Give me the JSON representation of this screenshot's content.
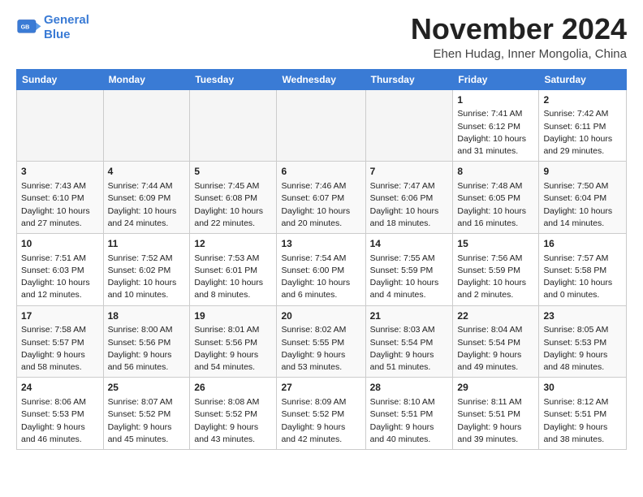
{
  "header": {
    "logo_line1": "General",
    "logo_line2": "Blue",
    "month": "November 2024",
    "location": "Ehen Hudag, Inner Mongolia, China"
  },
  "weekdays": [
    "Sunday",
    "Monday",
    "Tuesday",
    "Wednesday",
    "Thursday",
    "Friday",
    "Saturday"
  ],
  "weeks": [
    [
      {
        "day": "",
        "info": ""
      },
      {
        "day": "",
        "info": ""
      },
      {
        "day": "",
        "info": ""
      },
      {
        "day": "",
        "info": ""
      },
      {
        "day": "",
        "info": ""
      },
      {
        "day": "1",
        "info": "Sunrise: 7:41 AM\nSunset: 6:12 PM\nDaylight: 10 hours\nand 31 minutes."
      },
      {
        "day": "2",
        "info": "Sunrise: 7:42 AM\nSunset: 6:11 PM\nDaylight: 10 hours\nand 29 minutes."
      }
    ],
    [
      {
        "day": "3",
        "info": "Sunrise: 7:43 AM\nSunset: 6:10 PM\nDaylight: 10 hours\nand 27 minutes."
      },
      {
        "day": "4",
        "info": "Sunrise: 7:44 AM\nSunset: 6:09 PM\nDaylight: 10 hours\nand 24 minutes."
      },
      {
        "day": "5",
        "info": "Sunrise: 7:45 AM\nSunset: 6:08 PM\nDaylight: 10 hours\nand 22 minutes."
      },
      {
        "day": "6",
        "info": "Sunrise: 7:46 AM\nSunset: 6:07 PM\nDaylight: 10 hours\nand 20 minutes."
      },
      {
        "day": "7",
        "info": "Sunrise: 7:47 AM\nSunset: 6:06 PM\nDaylight: 10 hours\nand 18 minutes."
      },
      {
        "day": "8",
        "info": "Sunrise: 7:48 AM\nSunset: 6:05 PM\nDaylight: 10 hours\nand 16 minutes."
      },
      {
        "day": "9",
        "info": "Sunrise: 7:50 AM\nSunset: 6:04 PM\nDaylight: 10 hours\nand 14 minutes."
      }
    ],
    [
      {
        "day": "10",
        "info": "Sunrise: 7:51 AM\nSunset: 6:03 PM\nDaylight: 10 hours\nand 12 minutes."
      },
      {
        "day": "11",
        "info": "Sunrise: 7:52 AM\nSunset: 6:02 PM\nDaylight: 10 hours\nand 10 minutes."
      },
      {
        "day": "12",
        "info": "Sunrise: 7:53 AM\nSunset: 6:01 PM\nDaylight: 10 hours\nand 8 minutes."
      },
      {
        "day": "13",
        "info": "Sunrise: 7:54 AM\nSunset: 6:00 PM\nDaylight: 10 hours\nand 6 minutes."
      },
      {
        "day": "14",
        "info": "Sunrise: 7:55 AM\nSunset: 5:59 PM\nDaylight: 10 hours\nand 4 minutes."
      },
      {
        "day": "15",
        "info": "Sunrise: 7:56 AM\nSunset: 5:59 PM\nDaylight: 10 hours\nand 2 minutes."
      },
      {
        "day": "16",
        "info": "Sunrise: 7:57 AM\nSunset: 5:58 PM\nDaylight: 10 hours\nand 0 minutes."
      }
    ],
    [
      {
        "day": "17",
        "info": "Sunrise: 7:58 AM\nSunset: 5:57 PM\nDaylight: 9 hours\nand 58 minutes."
      },
      {
        "day": "18",
        "info": "Sunrise: 8:00 AM\nSunset: 5:56 PM\nDaylight: 9 hours\nand 56 minutes."
      },
      {
        "day": "19",
        "info": "Sunrise: 8:01 AM\nSunset: 5:56 PM\nDaylight: 9 hours\nand 54 minutes."
      },
      {
        "day": "20",
        "info": "Sunrise: 8:02 AM\nSunset: 5:55 PM\nDaylight: 9 hours\nand 53 minutes."
      },
      {
        "day": "21",
        "info": "Sunrise: 8:03 AM\nSunset: 5:54 PM\nDaylight: 9 hours\nand 51 minutes."
      },
      {
        "day": "22",
        "info": "Sunrise: 8:04 AM\nSunset: 5:54 PM\nDaylight: 9 hours\nand 49 minutes."
      },
      {
        "day": "23",
        "info": "Sunrise: 8:05 AM\nSunset: 5:53 PM\nDaylight: 9 hours\nand 48 minutes."
      }
    ],
    [
      {
        "day": "24",
        "info": "Sunrise: 8:06 AM\nSunset: 5:53 PM\nDaylight: 9 hours\nand 46 minutes."
      },
      {
        "day": "25",
        "info": "Sunrise: 8:07 AM\nSunset: 5:52 PM\nDaylight: 9 hours\nand 45 minutes."
      },
      {
        "day": "26",
        "info": "Sunrise: 8:08 AM\nSunset: 5:52 PM\nDaylight: 9 hours\nand 43 minutes."
      },
      {
        "day": "27",
        "info": "Sunrise: 8:09 AM\nSunset: 5:52 PM\nDaylight: 9 hours\nand 42 minutes."
      },
      {
        "day": "28",
        "info": "Sunrise: 8:10 AM\nSunset: 5:51 PM\nDaylight: 9 hours\nand 40 minutes."
      },
      {
        "day": "29",
        "info": "Sunrise: 8:11 AM\nSunset: 5:51 PM\nDaylight: 9 hours\nand 39 minutes."
      },
      {
        "day": "30",
        "info": "Sunrise: 8:12 AM\nSunset: 5:51 PM\nDaylight: 9 hours\nand 38 minutes."
      }
    ]
  ]
}
